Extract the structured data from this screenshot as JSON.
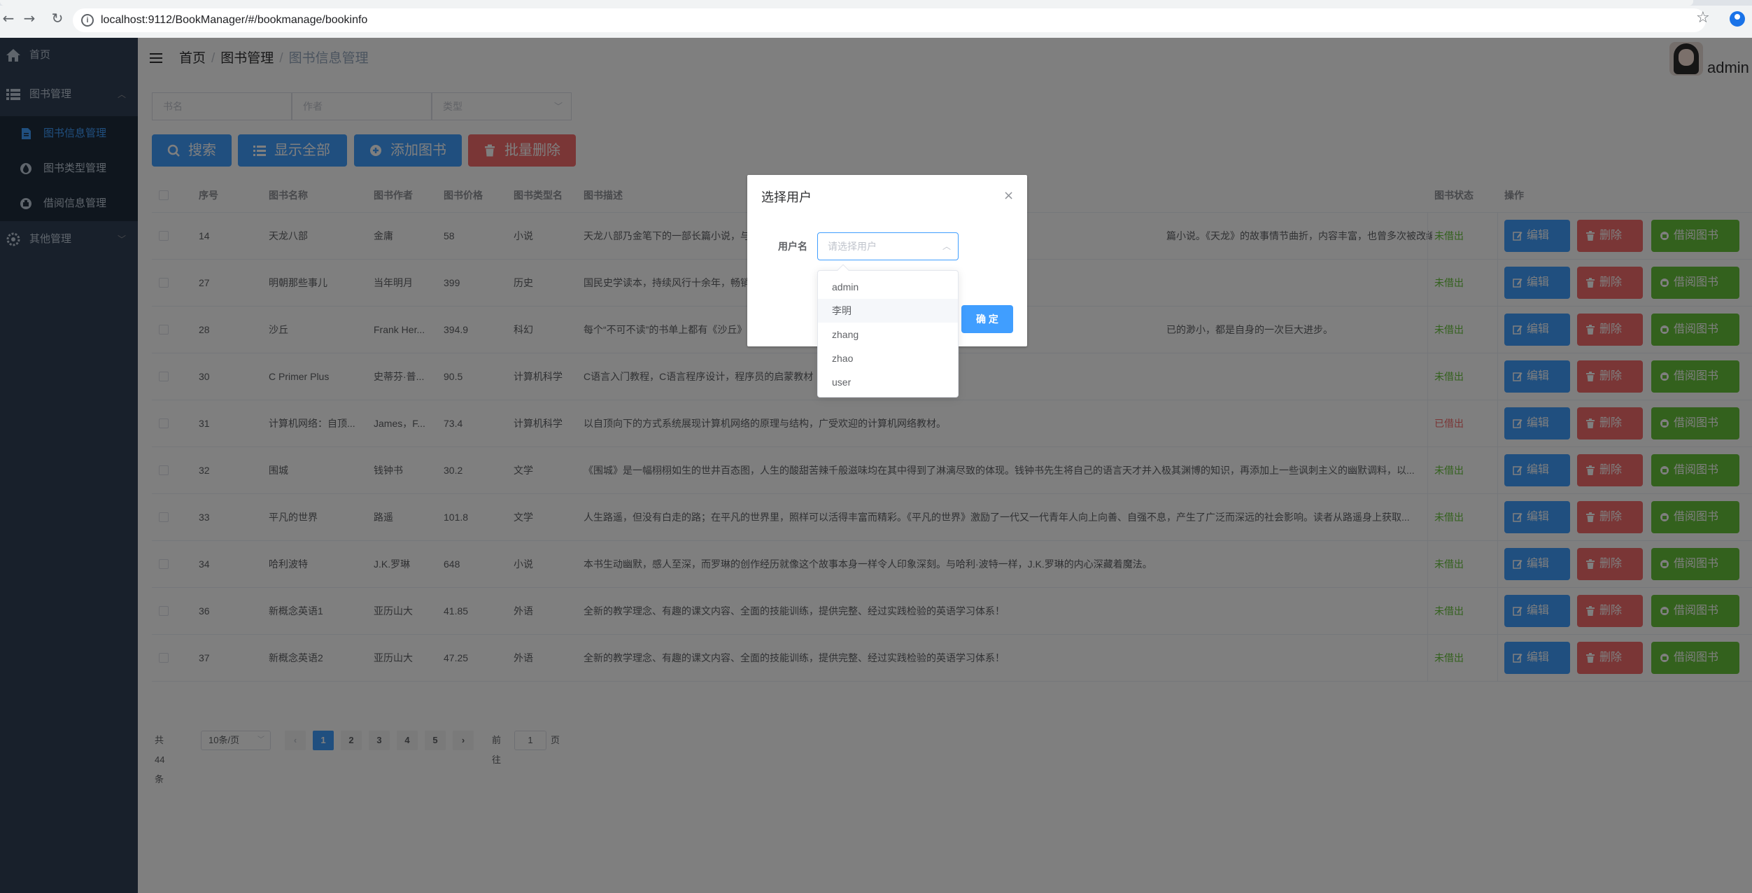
{
  "browser": {
    "url": "localhost:9112/BookManager/#/bookmanage/bookinfo"
  },
  "sidebar": {
    "items": [
      {
        "label": "首页",
        "icon": "home-icon"
      },
      {
        "label": "图书管理",
        "icon": "list-icon"
      },
      {
        "label": "其他管理",
        "icon": "gear-icon"
      }
    ],
    "sub_items": [
      {
        "label": "图书信息管理",
        "icon": "document-icon",
        "active": true
      },
      {
        "label": "图书类型管理",
        "icon": "drop-icon",
        "active": false
      },
      {
        "label": "借阅信息管理",
        "icon": "box-icon",
        "active": false
      }
    ]
  },
  "header": {
    "breadcrumb": [
      "首页",
      "图书管理",
      "图书信息管理"
    ],
    "user": "admin"
  },
  "filters": {
    "book_name_placeholder": "书名",
    "author_placeholder": "作者",
    "type_placeholder": "类型"
  },
  "toolbar": {
    "search": "搜索",
    "show_all": "显示全部",
    "add_book": "添加图书",
    "batch_delete": "批量删除"
  },
  "table": {
    "headers": [
      "序号",
      "图书名称",
      "图书作者",
      "图书价格",
      "图书类型名",
      "图书描述",
      "图书状态",
      "操作"
    ],
    "actions": {
      "edit": "编辑",
      "delete": "删除",
      "borrow": "借阅图书"
    },
    "rows": [
      {
        "id": "14",
        "name": "天龙八部",
        "author": "金庸",
        "price": "58",
        "type": "小说",
        "desc_left": "天龙八部乃金笔下的一部长篇小说，与",
        "desc_right": "篇小说。《天龙》的故事情节曲折，内容丰富，也曾多次被改编为电视作品。",
        "status": "未借出"
      },
      {
        "id": "27",
        "name": "明朝那些事儿",
        "author": "当年明月",
        "price": "399",
        "type": "历史",
        "desc_left": "国民史学读本，持续风行十余年，畅销",
        "desc_right": "",
        "status": "未借出"
      },
      {
        "id": "28",
        "name": "沙丘",
        "author": "Frank Her...",
        "price": "394.9",
        "type": "科幻",
        "desc_left": "每个“不可不读”的书单上都有《沙丘》",
        "desc_right": "已的渺小，都是自身的一次巨大进步。",
        "status": "未借出"
      },
      {
        "id": "30",
        "name": "C Primer Plus",
        "author": "史蒂芬·普...",
        "price": "90.5",
        "type": "计算机科学",
        "desc_left": "C语言入门教程，C语言程序设计，程序员的启蒙教材",
        "desc_right": "",
        "status": "未借出"
      },
      {
        "id": "31",
        "name": "计算机网络：自顶...",
        "author": "James，F...",
        "price": "73.4",
        "type": "计算机科学",
        "desc_left": "以自顶向下的方式系统展现计算机网络的原理与结构，广受欢迎的计算机网络教材。",
        "desc_right": "",
        "status": "已借出"
      },
      {
        "id": "32",
        "name": "围城",
        "author": "钱钟书",
        "price": "30.2",
        "type": "文学",
        "desc_left": "《围城》是一幅栩栩如生的世井百态图，人生的酸甜苦辣千般滋味均在其中得到了淋漓尽致的体现。钱钟书先生将自己的语言天才并入极其渊博的知识，再添加上一些讽刺主义的幽默调料，以...",
        "desc_right": "",
        "status": "未借出"
      },
      {
        "id": "33",
        "name": "平凡的世界",
        "author": "路遥",
        "price": "101.8",
        "type": "文学",
        "desc_left": "人生路遥，但没有白走的路；在平凡的世界里，照样可以活得丰富而精彩。《平凡的世界》激励了一代又一代青年人向上向善、自强不息，产生了广泛而深远的社会影响。读者从路遥身上获取...",
        "desc_right": "",
        "status": "未借出"
      },
      {
        "id": "34",
        "name": "哈利波特",
        "author": "J.K.罗琳",
        "price": "648",
        "type": "小说",
        "desc_left": "本书生动幽默，感人至深，而罗琳的创作经历就像这个故事本身一样令人印象深刻。与哈利·波特一样，J.K.罗琳的内心深藏着魔法。",
        "desc_right": "",
        "status": "未借出"
      },
      {
        "id": "36",
        "name": "新概念英语1",
        "author": "亚历山大",
        "price": "41.85",
        "type": "外语",
        "desc_left": "全新的教学理念、有趣的课文内容、全面的技能训练，提供完整、经过实践检验的英语学习体系！",
        "desc_right": "",
        "status": "未借出"
      },
      {
        "id": "37",
        "name": "新概念英语2",
        "author": "亚历山大",
        "price": "47.25",
        "type": "外语",
        "desc_left": "全新的教学理念、有趣的课文内容、全面的技能训练，提供完整、经过实践检验的英语学习体系！",
        "desc_right": "",
        "status": "未借出"
      }
    ]
  },
  "pagination": {
    "total": "共 44 条",
    "page_size": "10条/页",
    "prev": "‹",
    "next": "›",
    "pages": [
      "1",
      "2",
      "3",
      "4",
      "5"
    ],
    "current": "1",
    "goto_label": "前往",
    "goto_value": "1",
    "goto_unit": "页"
  },
  "dialog": {
    "title": "选择用户",
    "close": "×",
    "field_label": "用户名",
    "select_placeholder": "请选择用户",
    "confirm": "确 定",
    "options": [
      "admin",
      "李明",
      "zhang",
      "zhao",
      "user"
    ],
    "hovered_option": "李明"
  },
  "colors": {
    "sidebar_bg": "#304156",
    "primary": "#409eff",
    "danger": "#f56c6c",
    "success": "#67c23a"
  }
}
